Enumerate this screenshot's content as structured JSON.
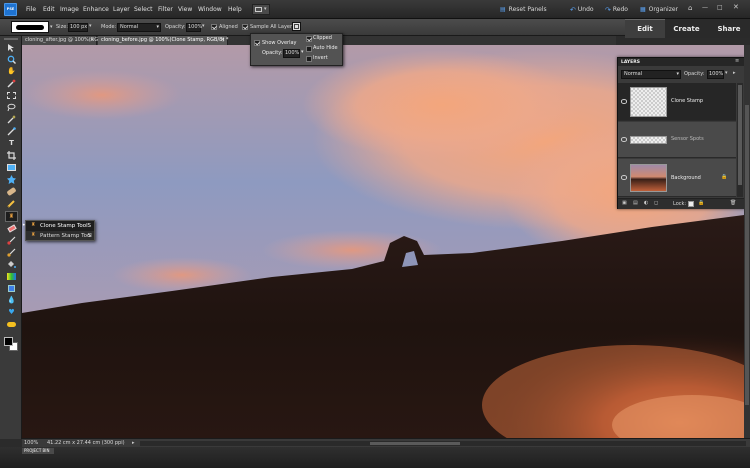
{
  "app": {
    "logo_letters": "PSE"
  },
  "menu": [
    "File",
    "Edit",
    "Image",
    "Enhance",
    "Layer",
    "Select",
    "Filter",
    "View",
    "Window",
    "Help"
  ],
  "top_actions": {
    "reset_panels": "Reset Panels",
    "undo": "Undo",
    "redo": "Redo",
    "organizer": "Organizer"
  },
  "mode_tabs": {
    "edit": "Edit",
    "create": "Create",
    "share": "Share"
  },
  "options": {
    "size_label": "Size:",
    "size_value": "100 px",
    "mode_label": "Mode:",
    "mode_value": "Normal",
    "opacity_label": "Opacity:",
    "opacity_value": "100%",
    "aligned_label": "Aligned",
    "aligned_checked": true,
    "sample_all_label": "Sample All Layers",
    "sample_all_checked": true
  },
  "overlay_popup": {
    "show_overlay_label": "Show Overlay",
    "show_overlay_checked": true,
    "opacity_label": "Opacity:",
    "opacity_value": "100%",
    "clipped_label": "Clipped",
    "clipped_checked": true,
    "auto_hide_label": "Auto Hide",
    "auto_hide_checked": false,
    "invert_label": "Invert",
    "invert_checked": false
  },
  "doc_tabs": [
    {
      "label": "cloning_after.jpg @ 100%(RGB/8)",
      "close": "×"
    },
    {
      "label": "cloning_before.jpg @ 100%(Clone Stamp, RGB/8) *",
      "close": "×"
    }
  ],
  "flyout": {
    "items": [
      {
        "label": "Clone Stamp Tool",
        "shortcut": "S"
      },
      {
        "label": "Pattern Stamp Tool",
        "shortcut": "S"
      }
    ]
  },
  "layers_panel": {
    "title": "LAYERS",
    "blend_mode": "Normal",
    "opacity_label": "Opacity:",
    "opacity_value": "100%",
    "layers": [
      {
        "name": "Clone Stamp"
      },
      {
        "name": "Sensor Spots"
      },
      {
        "name": "Background"
      }
    ],
    "lock_label": "Lock:"
  },
  "status": {
    "zoom": "100%",
    "doc_info": "41.22 cm x 27.44 cm (300 ppi)"
  },
  "project_bin": {
    "label": "PROJECT BIN"
  },
  "colors": {
    "accent": "#1e73d2",
    "chrome": "#3a3a3a",
    "menubar": "#262626"
  }
}
